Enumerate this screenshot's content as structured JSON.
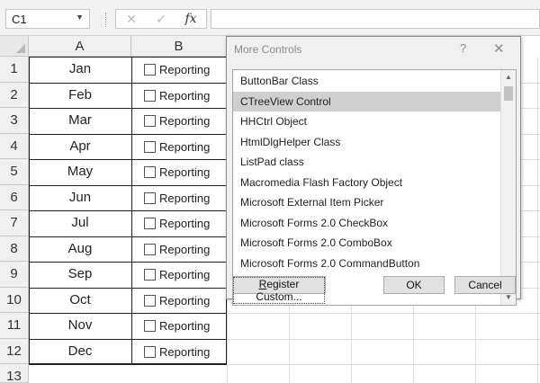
{
  "formula_bar": {
    "name_box": "C1",
    "cancel_icon": "✕",
    "enter_icon": "✓",
    "fx_icon": "fx"
  },
  "columns": [
    "A",
    "B"
  ],
  "rows": [
    {
      "num": "1",
      "month": "Jan",
      "checkbox_label": "Reporting",
      "checked": false
    },
    {
      "num": "2",
      "month": "Feb",
      "checkbox_label": "Reporting",
      "checked": false
    },
    {
      "num": "3",
      "month": "Mar",
      "checkbox_label": "Reporting",
      "checked": false
    },
    {
      "num": "4",
      "month": "Apr",
      "checkbox_label": "Reporting",
      "checked": false
    },
    {
      "num": "5",
      "month": "May",
      "checkbox_label": "Reporting",
      "checked": false
    },
    {
      "num": "6",
      "month": "Jun",
      "checkbox_label": "Reporting",
      "checked": false
    },
    {
      "num": "7",
      "month": "Jul",
      "checkbox_label": "Reporting",
      "checked": false
    },
    {
      "num": "8",
      "month": "Aug",
      "checkbox_label": "Reporting",
      "checked": false
    },
    {
      "num": "9",
      "month": "Sep",
      "checkbox_label": "Reporting",
      "checked": false
    },
    {
      "num": "10",
      "month": "Oct",
      "checkbox_label": "Reporting",
      "checked": false
    },
    {
      "num": "11",
      "month": "Nov",
      "checkbox_label": "Reporting",
      "checked": false
    },
    {
      "num": "12",
      "month": "Dec",
      "checkbox_label": "Reporting",
      "checked": false
    },
    {
      "num": "13",
      "month": "",
      "checkbox_label": "",
      "checked": false
    }
  ],
  "dialog": {
    "title": "More Controls",
    "help_label": "?",
    "close_label": "✕",
    "items": [
      "ButtonBar Class",
      "CTreeView Control",
      "HHCtrl Object",
      "HtmlDlgHelper Class",
      "ListPad class",
      "Macromedia Flash Factory Object",
      "Microsoft External Item Picker",
      "Microsoft Forms 2.0 CheckBox",
      "Microsoft Forms 2.0 ComboBox",
      "Microsoft Forms 2.0 CommandButton"
    ],
    "selected_index": 1,
    "register_label_pre": "",
    "register_label_key": "R",
    "register_label_post": "egister Custom...",
    "ok_label": "OK",
    "cancel_label": "Cancel"
  }
}
